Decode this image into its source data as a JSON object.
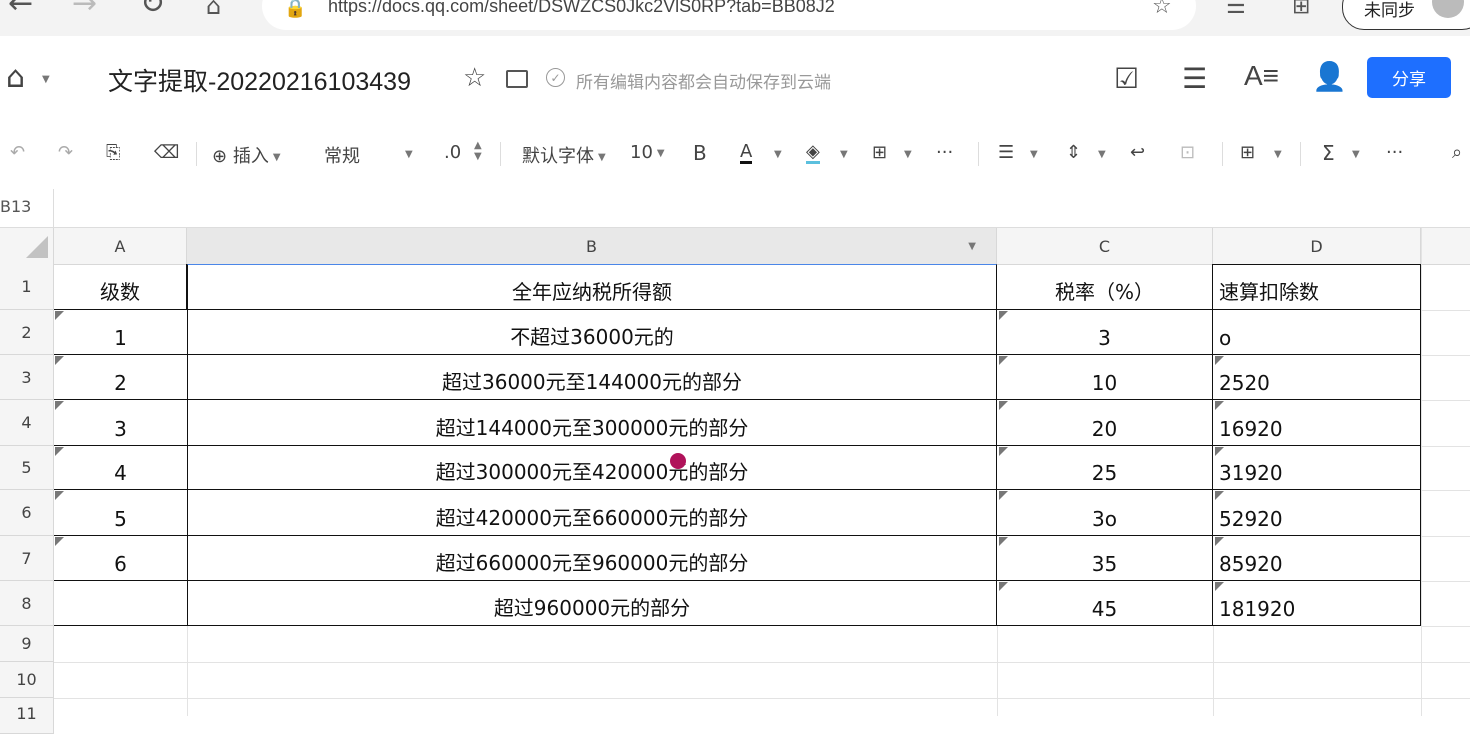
{
  "browser": {
    "url": "https://docs.qq.com/sheet/DSWZCS0Jkc2VlS0RP?tab=BB08J2",
    "sync_label": "未同步"
  },
  "header": {
    "title": "文字提取-20220216103439",
    "save_status": "所有编辑内容都会自动保存到云端",
    "share_label": "分享"
  },
  "toolbar": {
    "insert_label": "插入",
    "format_label": "常规",
    "decimal_label": ".0",
    "font_label": "默认字体",
    "font_size": "10",
    "bold_label": "B",
    "font_color_label": "A",
    "more_label": "···",
    "accent_color": "#1e6fff"
  },
  "namebox": {
    "cell_ref": "B13"
  },
  "columns": [
    "A",
    "B",
    "C",
    "D"
  ],
  "row_numbers": [
    "1",
    "2",
    "3",
    "4",
    "5",
    "6",
    "7",
    "8",
    "9",
    "10",
    "11"
  ],
  "table": {
    "header": [
      "级数",
      "全年应纳税所得额",
      "税率（%）",
      "速算扣除数"
    ],
    "rows": [
      [
        "1",
        "不超过36000元的",
        "3",
        "o"
      ],
      [
        "2",
        "超过36000元至144000元的部分",
        "10",
        "2520"
      ],
      [
        "3",
        "超过144000元至300000元的部分",
        "20",
        "16920"
      ],
      [
        "4",
        "超过300000元至420000元的部分",
        "25",
        "31920"
      ],
      [
        "5",
        "超过420000元至660000元的部分",
        "3o",
        "52920"
      ],
      [
        "6",
        "超过660000元至960000元的部分",
        "35",
        "85920"
      ],
      [
        "",
        "超过960000元的部分",
        "45",
        "181920"
      ]
    ]
  }
}
